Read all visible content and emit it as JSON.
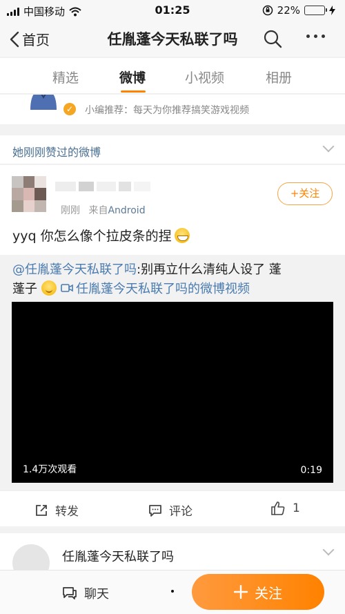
{
  "status_bar": {
    "carrier": "中国移动",
    "time": "01:25",
    "battery": "22%",
    "battery_level": 0.22
  },
  "nav": {
    "back_label": "首页",
    "title": "任胤蓬今天私联了吗"
  },
  "tabs": [
    {
      "label": "精选"
    },
    {
      "label": "微博",
      "active": true
    },
    {
      "label": "小视频"
    },
    {
      "label": "相册"
    }
  ],
  "recommend": {
    "text": "小编推荐：每天为你推荐搞笑游戏视频"
  },
  "liked_section": {
    "label": "她刚刚赞过的微博"
  },
  "post": {
    "time": "刚刚",
    "source_prefix": "来自",
    "source": "Android",
    "follow_label": "+关注",
    "text": "yyq 你怎么像个拉皮条的捏",
    "repost": {
      "mention": "@任胤蓬今天私联了吗",
      "text1": ":别再立什么清纯人设了 蓬",
      "text2": "蓬子",
      "video_link": "任胤蓬今天私联了吗的微博视频"
    },
    "video": {
      "views": "1.4万次观看",
      "duration": "0:19"
    },
    "actions": {
      "repost": "转发",
      "comment": "评论",
      "like_count": "1"
    }
  },
  "second_card": {
    "name": "任胤蓬今天私联了吗"
  },
  "bottom_bar": {
    "chat_label": "聊天",
    "follow_label": "关注"
  },
  "colors": {
    "accent": "#ff8200",
    "link": "#4a7bb0",
    "section_label": "#4a6f93"
  }
}
